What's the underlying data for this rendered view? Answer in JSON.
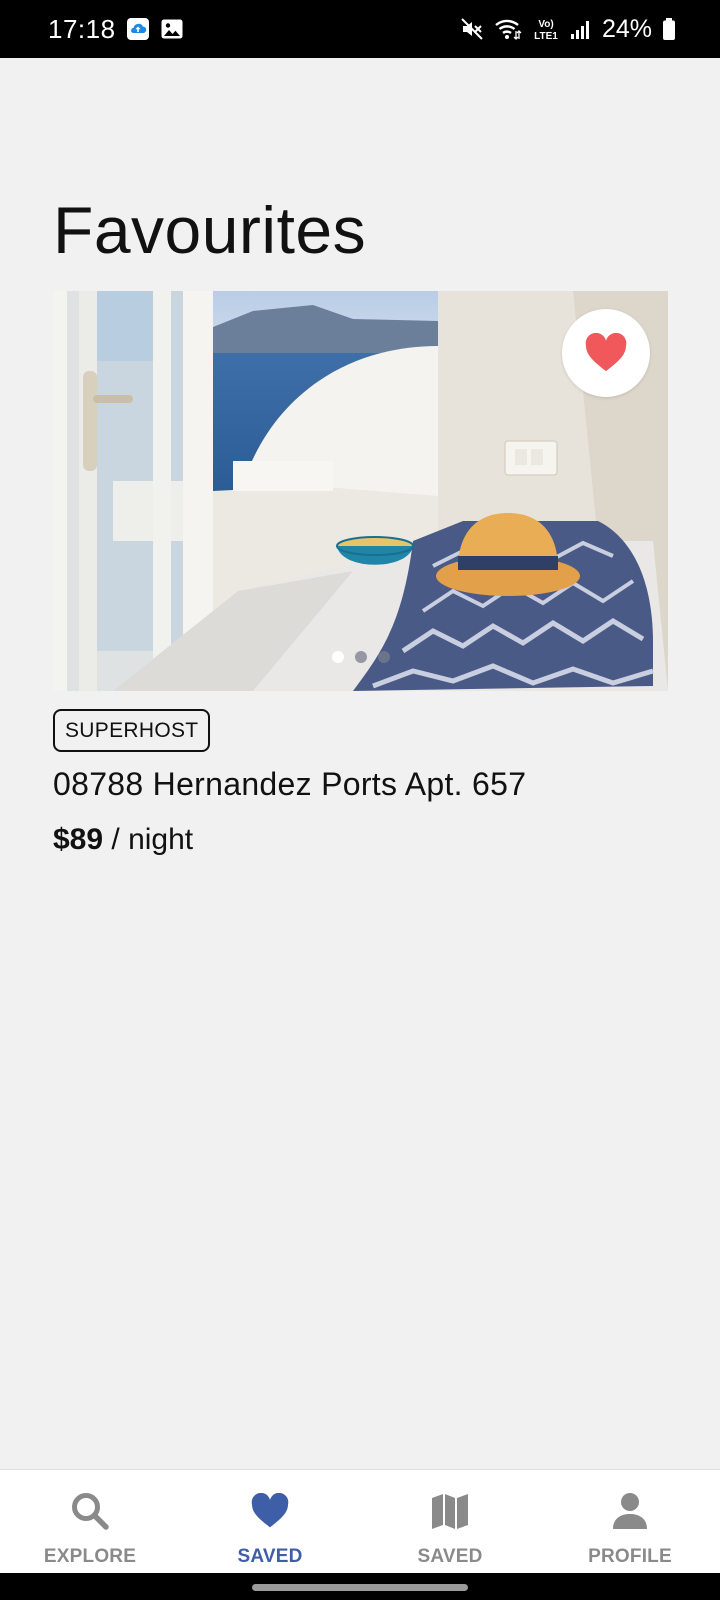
{
  "status_bar": {
    "time": "17:18",
    "battery_percent": "24%",
    "left_icons": [
      "cloud-upload-icon",
      "image-icon"
    ],
    "right_icons": [
      "mute-icon",
      "wifi-icon",
      "volte-icon",
      "signal-icon",
      "battery-icon"
    ],
    "volte_label": "Vo) LTE1"
  },
  "page": {
    "title": "Favourites"
  },
  "listing": {
    "is_favourite": true,
    "badge": "SUPERHOST",
    "address": "08788 Hernandez Ports Apt. 657",
    "price": "$89",
    "price_unit": "/ night",
    "photo_count": 3,
    "active_photo_index": 0,
    "heart_color": "#f0585c"
  },
  "bottom_nav": {
    "active_color": "#3e5fa8",
    "inactive_color": "#8a8a8a",
    "items": [
      {
        "label": "EXPLORE",
        "icon": "search-icon",
        "active": false
      },
      {
        "label": "SAVED",
        "icon": "heart-icon",
        "active": true
      },
      {
        "label": "SAVED",
        "icon": "map-icon",
        "active": false
      },
      {
        "label": "PROFILE",
        "icon": "person-icon",
        "active": false
      }
    ]
  }
}
